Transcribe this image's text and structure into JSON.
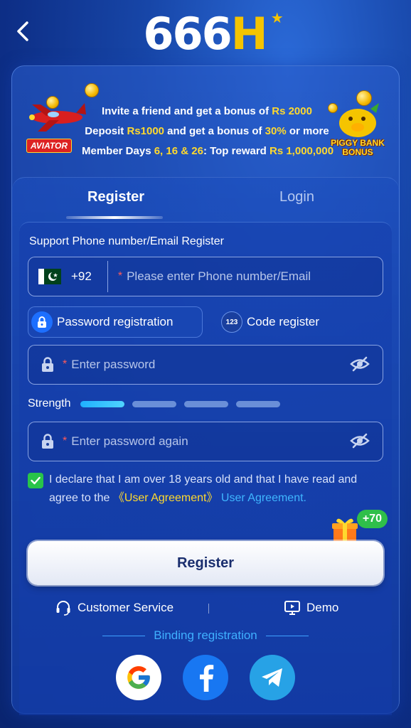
{
  "header": {
    "logo_number": "666",
    "logo_letter": "H"
  },
  "promo": {
    "aviator_label": "AVIATOR",
    "piggy_label_1": "PIGGY BANK",
    "piggy_label_2": "BONUS",
    "line1_a": "Invite a friend and get a bonus of ",
    "line1_b": "Rs 2000",
    "line2_a": "Deposit ",
    "line2_b": "Rs1000",
    "line2_c": " and get a bonus of ",
    "line2_d": "30%",
    "line2_e": " or more",
    "line3_a": "Member Days ",
    "line3_b": "6, 16 & 26",
    "line3_c": ": Top reward ",
    "line3_d": "Rs 1,000,000"
  },
  "tabs": {
    "register": "Register",
    "login": "Login"
  },
  "form": {
    "support_label": "Support Phone number/Email Register",
    "country_code": "+92",
    "phone_placeholder": "Please enter Phone number/Email",
    "password_registration": "Password registration",
    "code_icon": "123",
    "code_register": "Code register",
    "password_placeholder": "Enter password",
    "strength_label": "Strength",
    "strength_level": 1,
    "strength_total": 4,
    "confirm_placeholder": "Enter password again",
    "agree_text": "I declare that I am over 18 years old and that I have read and agree to the ",
    "agreement_link_1": "《User Agreement》",
    "agreement_link_2": "User Agreement.",
    "gift_badge": "+70",
    "register_button": "Register"
  },
  "footer": {
    "customer_service": "Customer Service",
    "demo": "Demo",
    "binding_label": "Binding registration"
  },
  "colors": {
    "accent_yellow": "#ffd92e",
    "link_blue": "#3fb6ff",
    "check_green": "#28c44a"
  }
}
